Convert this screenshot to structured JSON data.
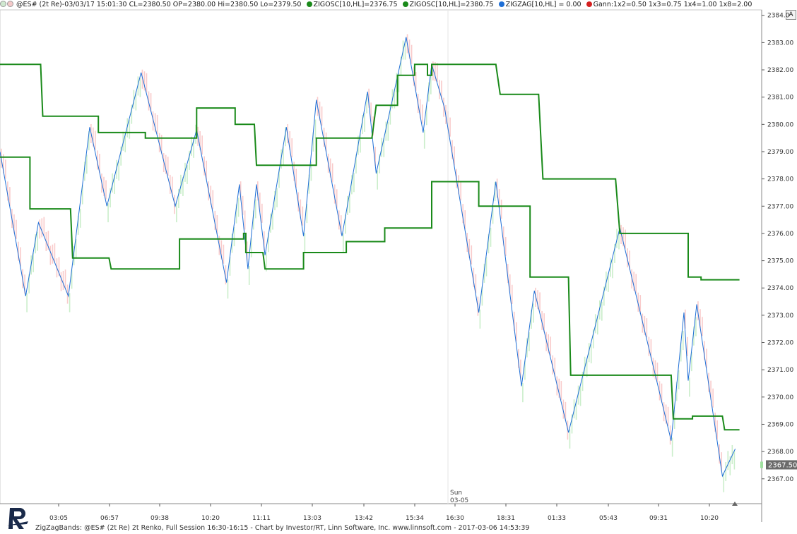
{
  "header": {
    "main": "@ES# (2t Re)-03/03/17 15:01:30 CL=2380.50 OP=2380.00 Hi=2380.50 Lo=2379.50",
    "items": [
      {
        "label": "ZIGOSC[10,HL]=2376.75",
        "color": "#1a8a1a"
      },
      {
        "label": "ZIGOSC[10,HL]=2380.75",
        "color": "#1a8a1a"
      },
      {
        "label": "ZIGZAG[10,HL] = 0.00",
        "color": "#1f6fd6"
      },
      {
        "label": "Gann:1x2=0.50  1x3=0.75  1x4=1.00  1x8=2.00",
        "color": "#d42020"
      }
    ]
  },
  "scale_button": "A",
  "footer": {
    "text": "ZigZagBands: @ES# (2t Re) 2t Renko, Full Session 16:30-16:15 - Chart by Investor/RT, Linn Software, Inc. www.linnsoft.com - 2017-03-06 14:53:39"
  },
  "chart_data": {
    "type": "line",
    "last_price_label": "2367.50",
    "day_marker": [
      "Sun",
      "03-05"
    ],
    "y_axis": {
      "ticks": [
        "2367.00",
        "2368.00",
        "2369.00",
        "2370.00",
        "2371.00",
        "2372.00",
        "2373.00",
        "2374.00",
        "2375.00",
        "2376.00",
        "2377.00",
        "2378.00",
        "2379.00",
        "2380.00",
        "2381.00",
        "2382.00",
        "2383.00",
        "2384.0"
      ]
    },
    "x_axis": {
      "ticks": [
        "03:05",
        "06:57",
        "09:38",
        "10:20",
        "11:11",
        "13:03",
        "13:42",
        "15:34",
        "16:30",
        "18:31",
        "01:33",
        "05:43",
        "09:31",
        "10:20"
      ]
    },
    "series": [
      {
        "type": "zigzag",
        "color": "#1f6fd6",
        "points": [
          [
            0,
            2379.0
          ],
          [
            6,
            2373.7
          ],
          [
            9,
            2376.4
          ],
          [
            16,
            2373.7
          ],
          [
            21,
            2379.9
          ],
          [
            25,
            2377.0
          ],
          [
            33,
            2381.9
          ],
          [
            41,
            2377.0
          ],
          [
            46,
            2379.8
          ],
          [
            53,
            2374.2
          ],
          [
            56,
            2377.8
          ],
          [
            58,
            2374.7
          ],
          [
            60,
            2377.8
          ],
          [
            62,
            2375.2
          ],
          [
            67,
            2379.9
          ],
          [
            71,
            2375.9
          ],
          [
            74,
            2380.9
          ],
          [
            80,
            2375.9
          ],
          [
            86,
            2381.2
          ],
          [
            88,
            2378.2
          ],
          [
            95,
            2383.2
          ],
          [
            99,
            2379.7
          ],
          [
            101,
            2382.2
          ],
          [
            104,
            2380.6
          ],
          [
            112,
            2373.1
          ],
          [
            116,
            2377.9
          ],
          [
            122,
            2370.4
          ],
          [
            125,
            2373.9
          ],
          [
            133,
            2368.7
          ],
          [
            145,
            2376.2
          ],
          [
            157,
            2368.4
          ],
          [
            160,
            2373.1
          ],
          [
            161,
            2370.6
          ],
          [
            163,
            2373.4
          ],
          [
            169,
            2367.1
          ],
          [
            172,
            2368.1
          ]
        ]
      },
      {
        "type": "band",
        "color": "#1a8a1a",
        "points": [
          [
            0,
            2382.2
          ],
          [
            9.5,
            2382.2
          ],
          [
            10,
            2380.3
          ],
          [
            23,
            2380.3
          ],
          [
            23,
            2379.7
          ],
          [
            34,
            2379.7
          ],
          [
            34,
            2379.5
          ],
          [
            46,
            2379.5
          ],
          [
            46,
            2380.6
          ],
          [
            55,
            2380.6
          ],
          [
            55,
            2380.0
          ],
          [
            59.5,
            2380.0
          ],
          [
            60,
            2378.5
          ],
          [
            74,
            2378.5
          ],
          [
            74,
            2379.5
          ],
          [
            87,
            2379.5
          ],
          [
            88,
            2380.7
          ],
          [
            93,
            2380.7
          ],
          [
            93,
            2381.8
          ],
          [
            97,
            2381.8
          ],
          [
            97,
            2382.2
          ],
          [
            100,
            2382.2
          ],
          [
            100,
            2381.8
          ],
          [
            101,
            2381.8
          ],
          [
            101,
            2382.2
          ],
          [
            116,
            2382.2
          ],
          [
            117,
            2381.1
          ],
          [
            126,
            2381.1
          ],
          [
            127,
            2378.0
          ],
          [
            144,
            2378.0
          ],
          [
            145,
            2376.0
          ],
          [
            161,
            2376.0
          ],
          [
            161,
            2374.4
          ],
          [
            164,
            2374.4
          ],
          [
            164,
            2374.3
          ],
          [
            173,
            2374.3
          ]
        ]
      },
      {
        "type": "band",
        "color": "#1a8a1a",
        "points": [
          [
            0,
            2378.8
          ],
          [
            7,
            2378.8
          ],
          [
            7,
            2376.9
          ],
          [
            16.5,
            2376.9
          ],
          [
            17,
            2375.1
          ],
          [
            25.5,
            2375.1
          ],
          [
            26,
            2374.7
          ],
          [
            42,
            2374.7
          ],
          [
            42,
            2375.8
          ],
          [
            57,
            2375.8
          ],
          [
            57,
            2376.0
          ],
          [
            57.5,
            2376.0
          ],
          [
            57.5,
            2375.3
          ],
          [
            61.5,
            2375.3
          ],
          [
            62,
            2374.7
          ],
          [
            71,
            2374.7
          ],
          [
            71,
            2375.3
          ],
          [
            81,
            2375.3
          ],
          [
            81,
            2375.7
          ],
          [
            90,
            2375.7
          ],
          [
            90,
            2376.2
          ],
          [
            101,
            2376.2
          ],
          [
            101,
            2377.9
          ],
          [
            112,
            2377.9
          ],
          [
            112,
            2377.0
          ],
          [
            124,
            2377.0
          ],
          [
            124,
            2374.4
          ],
          [
            133,
            2374.4
          ],
          [
            133.5,
            2370.8
          ],
          [
            157,
            2370.8
          ],
          [
            157.5,
            2369.2
          ],
          [
            162,
            2369.2
          ],
          [
            162,
            2369.3
          ],
          [
            169,
            2369.3
          ],
          [
            169.5,
            2368.8
          ],
          [
            173,
            2368.8
          ]
        ]
      }
    ]
  }
}
